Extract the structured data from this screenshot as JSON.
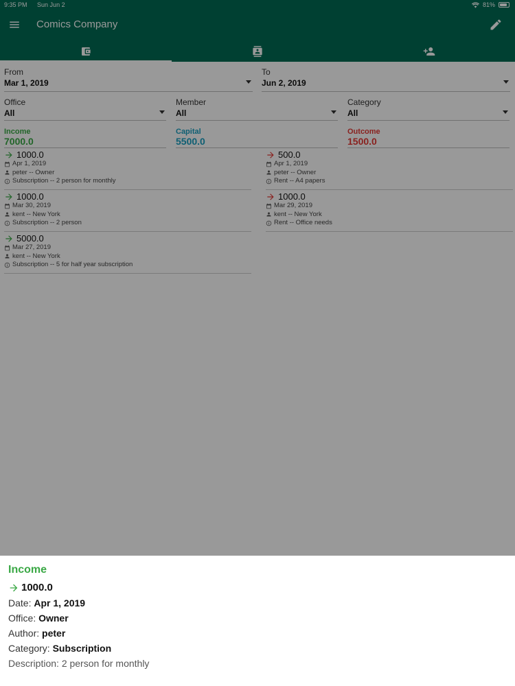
{
  "status": {
    "time": "9:35 PM",
    "date": "Sun Jun 2",
    "battery": "81%",
    "battery_level": 0.81
  },
  "appbar": {
    "title": "Comics Company"
  },
  "tabs": [
    {
      "icon": "wallet-icon",
      "active": true
    },
    {
      "icon": "contacts-icon",
      "active": false
    },
    {
      "icon": "add-person-icon",
      "active": false
    }
  ],
  "filters": {
    "from": {
      "label": "From",
      "value": "Mar 1, 2019"
    },
    "to": {
      "label": "To",
      "value": "Jun 2, 2019"
    },
    "office": {
      "label": "Office",
      "value": "All"
    },
    "member": {
      "label": "Member",
      "value": "All"
    },
    "category": {
      "label": "Category",
      "value": "All"
    }
  },
  "summary": {
    "income": {
      "label": "Income",
      "value": "7000.0",
      "color": "#3aa845"
    },
    "capital": {
      "label": "Capital",
      "value": "5500.0",
      "color": "#1a9fc0"
    },
    "outcome": {
      "label": "Outcome",
      "value": "1500.0",
      "color": "#e53935"
    }
  },
  "income_entries": [
    {
      "amount": "1000.0",
      "date": "Apr 1, 2019",
      "who": "peter -- Owner",
      "note": "Subscription -- 2 person for monthly"
    },
    {
      "amount": "1000.0",
      "date": "Mar 30, 2019",
      "who": "kent -- New York",
      "note": "Subscription -- 2 person"
    },
    {
      "amount": "5000.0",
      "date": "Mar 27, 2019",
      "who": "kent -- New York",
      "note": "Subscription -- 5 for half year subscription"
    }
  ],
  "outcome_entries": [
    {
      "amount": "500.0",
      "date": "Apr 1, 2019",
      "who": "peter -- Owner",
      "note": "Rent -- A4 papers"
    },
    {
      "amount": "1000.0",
      "date": "Mar 29, 2019",
      "who": "kent -- New York",
      "note": "Rent -- Office needs"
    }
  ],
  "sheet": {
    "title": "Income",
    "amount": "1000.0",
    "date_label": "Date: ",
    "date": "Apr 1, 2019",
    "office_label": "Office: ",
    "office": "Owner",
    "author_label": "Author: ",
    "author": "peter",
    "category_label": "Category: ",
    "category": "Subscription",
    "description_label": "Description: ",
    "description": "2 person for monthly"
  }
}
